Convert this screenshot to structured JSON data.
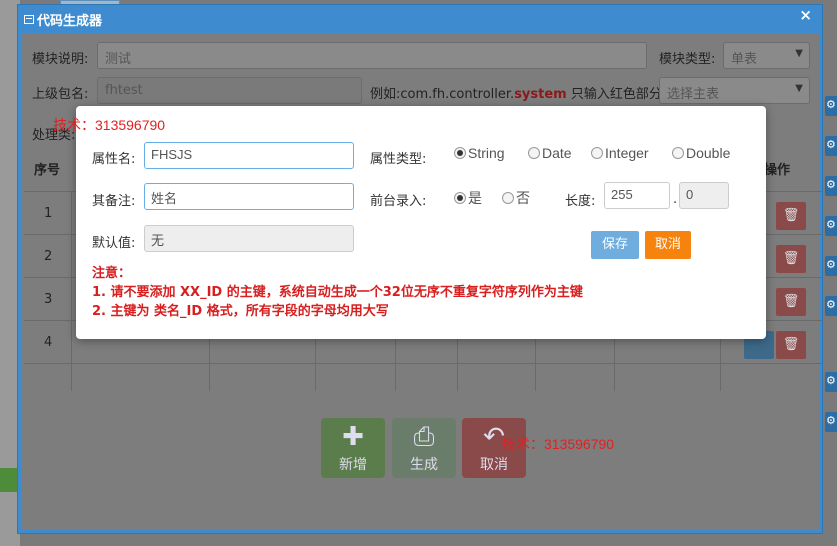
{
  "window": {
    "title": "代码生成器",
    "close": "×"
  },
  "form": {
    "module_desc_label": "模块说明:",
    "module_desc_value": "测试",
    "module_type_label": "模块类型:",
    "module_type_value": "单表",
    "package_label": "上级包名:",
    "package_value": "fhtest",
    "package_hint_prefix": "例如:com.fh.controller.",
    "package_hint_red": "system",
    "package_hint_suffix": " 只输入红色部分",
    "main_table_placeholder": "选择主表",
    "process_label": "处理类:"
  },
  "table": {
    "col_index": "序号",
    "col_action": "操作",
    "rows": [
      "1",
      "2",
      "3",
      "4"
    ]
  },
  "bottom_buttons": {
    "add": "新增",
    "generate": "生成",
    "cancel": "取消"
  },
  "modal": {
    "attr_name_label": "属性名:",
    "attr_name_value": "FHSJS",
    "attr_type_label": "属性类型:",
    "type_options": [
      "String",
      "Date",
      "Integer",
      "Double"
    ],
    "type_selected": "String",
    "remark_label": "其备注:",
    "remark_value": "姓名",
    "front_input_label": "前台录入:",
    "front_yes": "是",
    "front_no": "否",
    "front_selected": "是",
    "length_label": "长度:",
    "length_value": "255",
    "length_sep": ".",
    "decimal_value": "0",
    "default_label": "默认值:",
    "default_value": "无",
    "save": "保存",
    "cancel": "取消",
    "note_title": "注意：",
    "note_1": "1. 请不要添加 XX_ID 的主键，系统自动生成一个32位无序不重复字符序列作为主键",
    "note_2": "2. 主键为 类名_ID 格式，所有字段的字母均用大写"
  },
  "watermark": {
    "top_left": "技术：313596790",
    "bottom": "技术：313596790"
  },
  "colors": {
    "window_blue": "#3e8ccf",
    "save_blue": "#6faddf",
    "cancel_orange": "#f6830d",
    "note_red": "#d81e1e"
  }
}
